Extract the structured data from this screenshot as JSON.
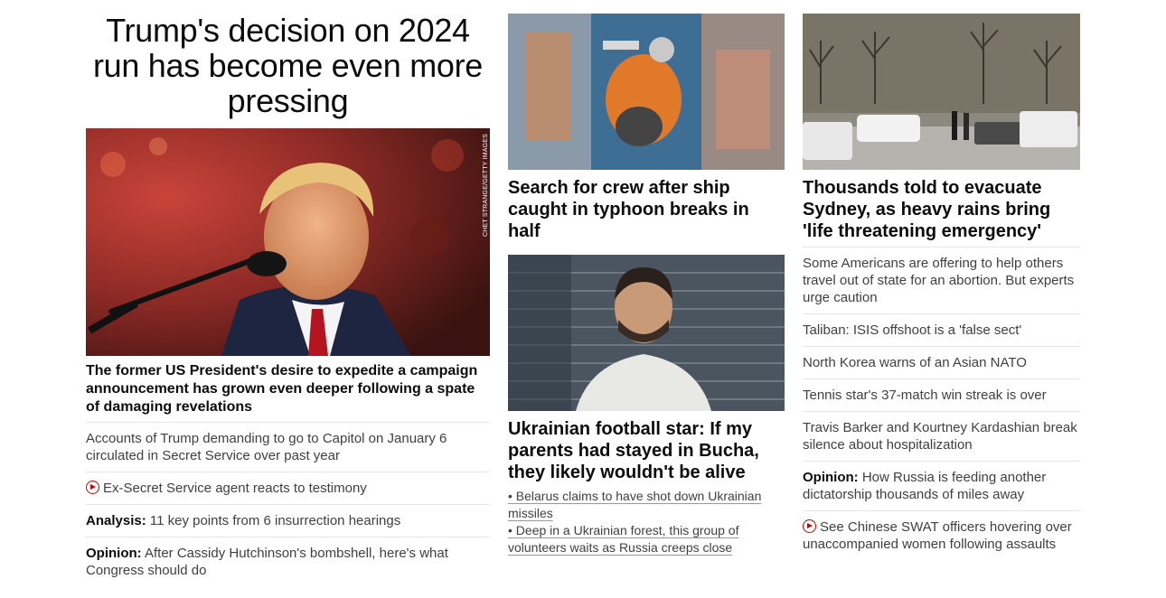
{
  "lead": {
    "headline": "Trump's decision on 2024 run has become even more pressing",
    "image_credit": "CHET STRANGE/GETTY IMAGES",
    "subheadline": "The former US President's desire to expedite a campaign announcement has grown even deeper following a spate of damaging revelations",
    "related": [
      {
        "prefix": "",
        "text": "Accounts of Trump demanding to go to Capitol on January 6 circulated in Secret Service over past year",
        "video": false
      },
      {
        "prefix": "",
        "text": "Ex-Secret Service agent reacts to testimony",
        "video": true
      },
      {
        "prefix": "Analysis:",
        "text": " 11 key points from 6 insurrection hearings",
        "video": false
      },
      {
        "prefix": "Opinion:",
        "text": " After Cassidy Hutchinson's bombshell, here's what Congress should do",
        "video": false
      }
    ]
  },
  "middle": {
    "story1": {
      "headline": "Search for crew after ship caught in typhoon breaks in half"
    },
    "story2": {
      "headline": "Ukrainian football star: If my parents had stayed in Bucha, they likely wouldn't be alive",
      "bullets": [
        "• Belarus claims to have shot down Ukrainian missiles",
        "• Deep in a Ukrainian forest, this group of volunteers waits as Russia creeps close"
      ]
    }
  },
  "right": {
    "headline": "Thousands told to evacuate Sydney, as heavy rains bring 'life threatening emergency'",
    "list": [
      {
        "prefix": "",
        "text": "Some Americans are offering to help others travel out of state for an abortion. But experts urge caution",
        "video": false
      },
      {
        "prefix": "",
        "text": "Taliban: ISIS offshoot is a 'false sect'",
        "video": false
      },
      {
        "prefix": "",
        "text": "North Korea warns of an Asian NATO",
        "video": false
      },
      {
        "prefix": "",
        "text": "Tennis star's 37-match win streak is over",
        "video": false
      },
      {
        "prefix": "",
        "text": "Travis Barker and Kourtney Kardashian break silence about hospitalization",
        "video": false
      },
      {
        "prefix": "Opinion:",
        "text": " How Russia is feeding another dictatorship thousands of miles away",
        "video": false
      },
      {
        "prefix": "",
        "text": "See Chinese SWAT officers hovering over unaccompanied women following assaults",
        "video": true
      }
    ]
  }
}
